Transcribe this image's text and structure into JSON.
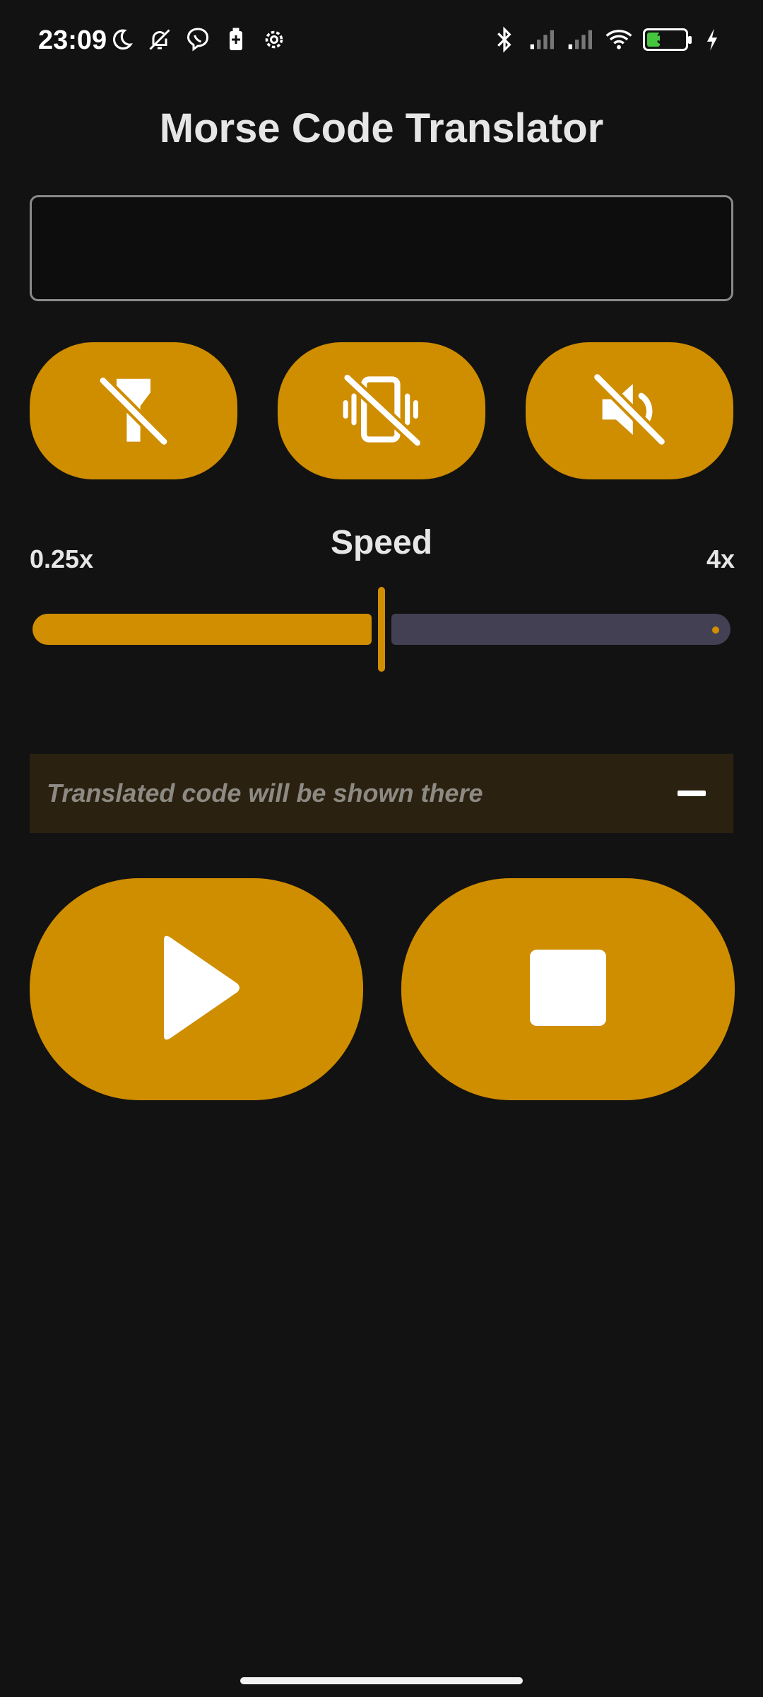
{
  "status_bar": {
    "time": "23:09",
    "left_icons": [
      "moon-icon",
      "bell-off-icon",
      "viber-icon",
      "battery-saver-icon",
      "settings-icon"
    ],
    "right_icons": [
      "bluetooth-icon",
      "signal-1-icon",
      "signal-2-icon",
      "wifi-icon"
    ],
    "battery_level": "34",
    "battery_fraction": 0.34,
    "charging": true
  },
  "app": {
    "title": "Morse Code Translator"
  },
  "input": {
    "value": "",
    "placeholder": ""
  },
  "toggles": [
    {
      "name": "flashlight-off",
      "icon": "flashlight-off-icon",
      "state": "off"
    },
    {
      "name": "vibration-off",
      "icon": "vibration-off-icon",
      "state": "off"
    },
    {
      "name": "sound-off",
      "icon": "volume-off-icon",
      "state": "off"
    }
  ],
  "speed": {
    "label": "Speed",
    "min_label": "0.25x",
    "max_label": "4x",
    "value_fraction": 0.5
  },
  "output": {
    "placeholder": "Translated code will be shown there",
    "action_icon": "minus-icon"
  },
  "controls": {
    "play_icon": "play-icon",
    "stop_icon": "stop-icon"
  },
  "colors": {
    "accent": "#cf8d00",
    "background": "#121212",
    "inactive_track": "#434053",
    "output_bg": "#2a2110"
  }
}
